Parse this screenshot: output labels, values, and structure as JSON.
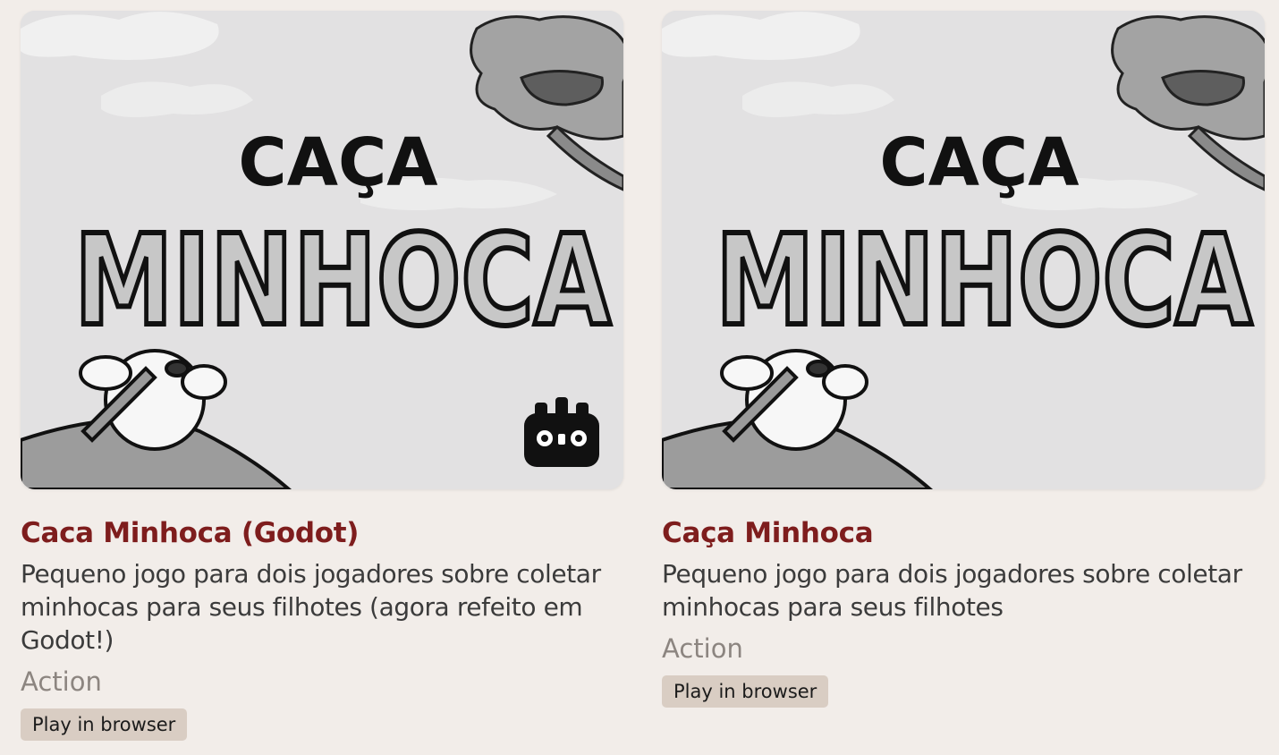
{
  "games": [
    {
      "title": "Caca Minhoca (Godot)",
      "description": "Pequeno jogo para dois jogadores sobre coletar minhocas para seus filhotes (agora refeito em Godot!)",
      "genre": "Action",
      "play_label": "Play in browser",
      "cover": {
        "line1": "CAÇA",
        "line2": "MINHOCA",
        "engine_badge_icon": "godot-logo-icon"
      }
    },
    {
      "title": "Caça Minhoca",
      "description": "Pequeno jogo para dois jogadores sobre coletar minhocas para seus filhotes",
      "genre": "Action",
      "play_label": "Play in browser",
      "cover": {
        "line1": "CAÇA",
        "line2": "MINHOCA"
      }
    }
  ],
  "colors": {
    "title": "#7e1d1d",
    "tag_bg": "#d9cdc3",
    "page_bg": "#f2ede9"
  }
}
